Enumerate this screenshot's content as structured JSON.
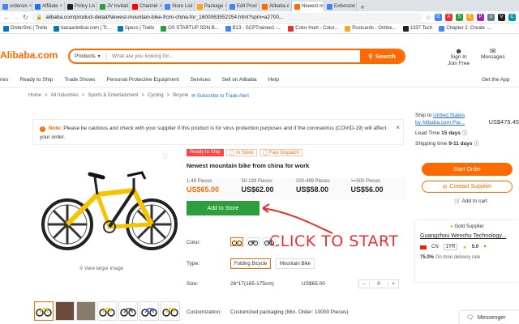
{
  "browser": {
    "tabs": [
      {
        "label": "ordersin",
        "color": "#4285f4"
      },
      {
        "label": "Affiliate",
        "color": "#1877f2"
      },
      {
        "label": "Policy Lis",
        "color": "#222222"
      },
      {
        "label": "JV Invitati",
        "color": "#2e9d3b"
      },
      {
        "label": "Channel",
        "color": "#ff0000"
      },
      {
        "label": "Store List",
        "color": "#4285f4"
      },
      {
        "label": "Package",
        "color": "#f5a623"
      },
      {
        "label": "Edit Prod",
        "color": "#4285f4"
      },
      {
        "label": "Alibaba.c",
        "color": "#ff6a00"
      },
      {
        "label": "Newest m",
        "color": "#ff6a00"
      },
      {
        "label": "Extension",
        "color": "#4285f4"
      }
    ],
    "url": "alibaba.com/product-detail/Newest-mountain-bike-from-china-for_1600063552254.html?spm=a2700...",
    "bookmarks": [
      "OrderSmi | Trello",
      "bazaarlotikal.com | Tr...",
      "Specs | Trello",
      "OS STARTUP SDN B...",
      "B13 - SCPTrainee1 -...",
      "Color Hunt - Color...",
      "Postcards - Online...",
      "1337 Tech",
      "Chapter 2: Create -..."
    ]
  },
  "header": {
    "logo": "Alibaba.com",
    "search_category": "Products",
    "search_placeholder": "What are you looking for...",
    "search_button": "Search",
    "signin": "Sign In",
    "join": "Join Free",
    "messages": "Messages"
  },
  "nav": {
    "items": [
      "ries",
      "Ready to Ship",
      "Trade Shows",
      "Personal Protective Equipment",
      "Services",
      "Sell on Alibaba",
      "Help"
    ],
    "get_app": "Get the App"
  },
  "breadcrumb": {
    "items": [
      "Home",
      "All Industries",
      "Sports & Entertainment",
      "Cycling",
      "Bicycle"
    ],
    "subscribe": "Subscribe to Trade Alert"
  },
  "notice": {
    "label": "Note:",
    "text": "Please be cautious and check with your supplier if this product is for virus protection purposes and if the coronavirus (COVID-19) will affect your order."
  },
  "product": {
    "tag_ready": "Ready to Ship",
    "tag_stock": "In Stock",
    "tag_dispatch": "Fast Dispatch",
    "title": "Newest mountain bike from china for work",
    "view_larger": "View larger image",
    "prices": [
      {
        "qty": "1-49 Pieces",
        "price": "US$65.00"
      },
      {
        "qty": "50-199 Pieces",
        "price": "US$62.00"
      },
      {
        "qty": "200-499 Pieces",
        "price": "US$58.00"
      },
      {
        "qty": ">=500 Pieces",
        "price": "US$56.00"
      }
    ],
    "add_to_store": "Add to Store",
    "color_label": "Color:",
    "type_label": "Type:",
    "types": [
      "Folding Bicycle",
      "Mountain Bike"
    ],
    "size_label": "Size:",
    "size_value": "26*17(165-175cm)",
    "size_price": "US$65.00",
    "qty_value": "0",
    "customization_label": "Customization:",
    "customization_value": "Customized packaging (Min. Order: 10000 Pieces)"
  },
  "annotation": {
    "text": "CLICK TO START"
  },
  "side": {
    "ship_to": "Ship to",
    "ship_country": "United States",
    "ship_by": "by Alibaba.com Par...",
    "ship_price": "US$479.45",
    "lead_label": "Lead Time",
    "lead_value": "15 days",
    "shipping_label": "Shipping time",
    "shipping_value": "9-11 days",
    "start_order": "Start Order",
    "contact": "Contact Supplier",
    "add_cart": "Add to cart",
    "gold": "Gold Supplier",
    "company": "Guangzhou Wenchu Technology...",
    "country": "CN",
    "years": "1YR",
    "rating": "5.0",
    "ontime_pct": "75.0%",
    "ontime_label": "On-time delivery rate"
  },
  "messenger": "Messenger"
}
